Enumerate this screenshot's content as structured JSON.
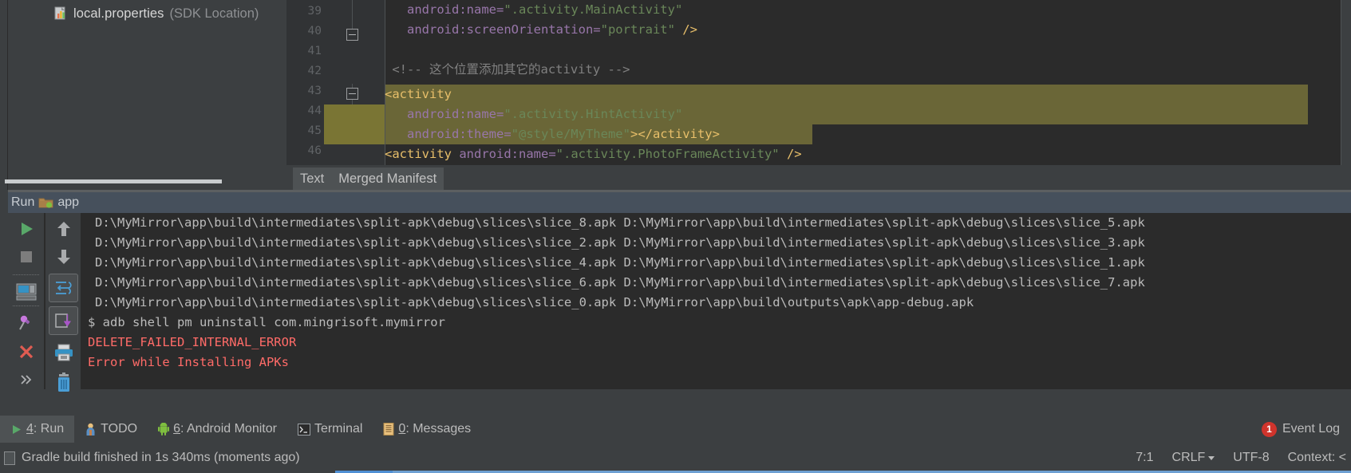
{
  "file_tab": {
    "icon": "properties-file-icon",
    "name": "local.properties",
    "subtitle": "(SDK Location)"
  },
  "editor": {
    "lines": [
      {
        "num": "39",
        "text": "android:name=\".activity.MainActivity\""
      },
      {
        "num": "40",
        "text": "android:screenOrientation=\"portrait\" />"
      },
      {
        "num": "41",
        "text": ""
      },
      {
        "num": "42",
        "text": "<!-- 这个位置添加其它的activity -->"
      },
      {
        "num": "43",
        "text": "<activity"
      },
      {
        "num": "44",
        "text": "android:name=\".activity.HintActivity\""
      },
      {
        "num": "45",
        "text": "android:theme=\"@style/MyTheme\"></activity>"
      },
      {
        "num": "46",
        "text": "<activity android:name=\".activity.PhotoFrameActivity\" />"
      }
    ],
    "tokens": {
      "l39_attr": "android:name=",
      "l39_val": "\".activity.MainActivity\"",
      "l40_attr": "android:screenOrientation=",
      "l40_val": "\"portrait\"",
      "l40_close": " />",
      "l42_comment": "<!-- 这个位置添加其它的activity -->",
      "l43_tag": "<activity",
      "l44_attr": "android:name=",
      "l44_val": "\".activity.HintActivity\"",
      "l45_attr": "android:theme=",
      "l45_val": "\"@style/MyTheme\"",
      "l45_gt": ">",
      "l45_endtag": "</activity>",
      "l46_tag": "<activity",
      "l46_attr": " android:name=",
      "l46_val": "\".activity.PhotoFrameActivity\"",
      "l46_close": " />"
    },
    "tabs": [
      {
        "label": "Text",
        "active": true
      },
      {
        "label": "Merged Manifest",
        "active": false
      }
    ]
  },
  "run_window": {
    "title": "Run",
    "config_name": "app",
    "config_icon": "android-folder-icon",
    "toolbar_left": [
      {
        "name": "rerun-button",
        "icon": "play-icon"
      },
      {
        "name": "stop-button",
        "icon": "stop-square-icon"
      },
      {
        "name": "show-console-button",
        "icon": "console-layout-icon"
      },
      {
        "name": "pin-tab-button",
        "icon": "pin-icon"
      },
      {
        "name": "close-button",
        "icon": "close-x-icon"
      },
      {
        "name": "more-options-button",
        "icon": "chevron-double-right-icon"
      }
    ],
    "toolbar_right": [
      {
        "name": "up-the-stack-trace-button",
        "icon": "arrow-up-icon"
      },
      {
        "name": "down-the-stack-trace-button",
        "icon": "arrow-down-icon"
      },
      {
        "name": "soft-wrap-button",
        "icon": "soft-wrap-icon"
      },
      {
        "name": "scroll-to-end-button",
        "icon": "scroll-to-end-icon"
      },
      {
        "name": "print-button",
        "icon": "printer-icon"
      },
      {
        "name": "clear-all-button",
        "icon": "trash-icon"
      }
    ],
    "console_lines": [
      {
        "text": "D:\\MyMirror\\app\\build\\intermediates\\split-apk\\debug\\slices\\slice_8.apk D:\\MyMirror\\app\\build\\intermediates\\split-apk\\debug\\slices\\slice_5.apk",
        "type": "normal"
      },
      {
        "text": "D:\\MyMirror\\app\\build\\intermediates\\split-apk\\debug\\slices\\slice_2.apk D:\\MyMirror\\app\\build\\intermediates\\split-apk\\debug\\slices\\slice_3.apk",
        "type": "normal"
      },
      {
        "text": "D:\\MyMirror\\app\\build\\intermediates\\split-apk\\debug\\slices\\slice_4.apk D:\\MyMirror\\app\\build\\intermediates\\split-apk\\debug\\slices\\slice_1.apk",
        "type": "normal"
      },
      {
        "text": "D:\\MyMirror\\app\\build\\intermediates\\split-apk\\debug\\slices\\slice_6.apk D:\\MyMirror\\app\\build\\intermediates\\split-apk\\debug\\slices\\slice_7.apk",
        "type": "normal"
      },
      {
        "text": "D:\\MyMirror\\app\\build\\intermediates\\split-apk\\debug\\slices\\slice_0.apk D:\\MyMirror\\app\\build\\outputs\\apk\\app-debug.apk",
        "type": "normal"
      },
      {
        "text": "$ adb shell pm uninstall com.mingrisoft.mymirror",
        "type": "cmd"
      },
      {
        "text": "DELETE_FAILED_INTERNAL_ERROR",
        "type": "error"
      },
      {
        "text": "Error while Installing APKs",
        "type": "error"
      }
    ]
  },
  "bottom_tabs": [
    {
      "mnemonic": "4",
      "label": ": Run",
      "icon": "play-green-icon",
      "active": true
    },
    {
      "mnemonic": "",
      "label": "TODO",
      "icon": "todo-icon",
      "active": false
    },
    {
      "mnemonic": "6",
      "label": ": Android Monitor",
      "icon": "android-icon",
      "active": false
    },
    {
      "mnemonic": "",
      "label": "Terminal",
      "icon": "terminal-icon",
      "active": false
    },
    {
      "mnemonic": "0",
      "label": ": Messages",
      "icon": "messages-icon",
      "active": false
    }
  ],
  "event_log": {
    "count": "1",
    "label": "Event Log"
  },
  "status_bar": {
    "message": "Gradle build finished in 1s 340ms (moments ago)",
    "caret_position": "7:1",
    "line_separator": "CRLF",
    "encoding": "UTF-8",
    "context": "Context: <"
  },
  "colors": {
    "editor_bg": "#2b2b2b",
    "panel_bg": "#3c3f41",
    "run_header_bg": "#46505c",
    "highlight": "#6a6637",
    "error_red": "#ff6b68",
    "accent_blue": "#4f8fd4"
  }
}
